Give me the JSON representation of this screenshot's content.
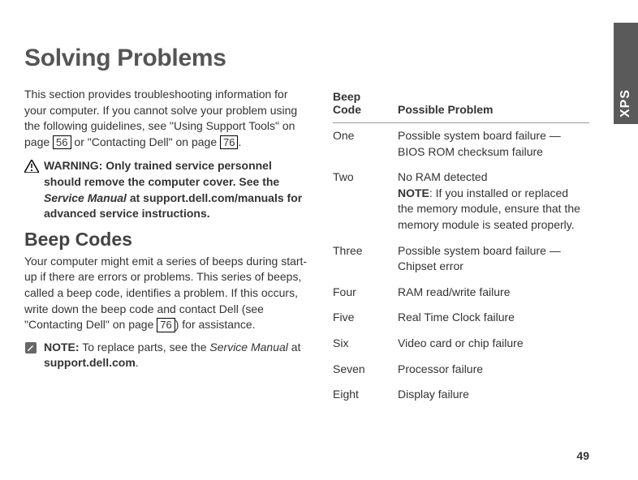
{
  "brand_tab": "XPS",
  "page_title": "Solving Problems",
  "intro_part1": "This section provides troubleshooting information for your computer. If you cannot solve your problem using the following guidelines, see \"Using Support Tools\" on page ",
  "page_ref_1": "56",
  "intro_part2": " or \"Contacting Dell\" on page ",
  "page_ref_2": "76",
  "intro_part3": ".",
  "warning": {
    "prefix": "WARNING: Only trained service personnel should remove the computer cover. See the ",
    "manual": "Service Manual",
    "suffix": " at support.dell.com/manuals for advanced service instructions."
  },
  "section_heading": "Beep Codes",
  "beep_intro_part1": "Your computer might emit a series of beeps during start-up if there are errors or problems. This series of beeps, called a beep code, identifies a problem. If this occurs, write down the beep code and contact Dell (see \"Contacting Dell\" on page ",
  "page_ref_3": "76",
  "beep_intro_part2": ") for assistance.",
  "note": {
    "label": "NOTE:",
    "text_part1": " To replace parts, see the ",
    "manual": "Service Manual",
    "text_part2": " at ",
    "site": "support.dell.com",
    "text_part3": "."
  },
  "table": {
    "header_code": "Beep Code",
    "header_problem": "Possible Problem",
    "rows": [
      {
        "code": "One",
        "problem": "Possible system board failure — BIOS ROM checksum failure",
        "has_note": false
      },
      {
        "code": "Two",
        "problem": "No RAM detected",
        "has_note": true,
        "note_label": "NOTE",
        "note_text": ": If you installed or replaced the memory module, ensure that the memory module is seated properly."
      },
      {
        "code": "Three",
        "problem": "Possible system board failure — Chipset error",
        "has_note": false
      },
      {
        "code": "Four",
        "problem": "RAM read/write failure",
        "has_note": false
      },
      {
        "code": "Five",
        "problem": "Real Time Clock failure",
        "has_note": false
      },
      {
        "code": "Six",
        "problem": "Video card or chip failure",
        "has_note": false
      },
      {
        "code": "Seven",
        "problem": "Processor failure",
        "has_note": false
      },
      {
        "code": "Eight",
        "problem": "Display failure",
        "has_note": false
      }
    ]
  },
  "page_number": "49"
}
